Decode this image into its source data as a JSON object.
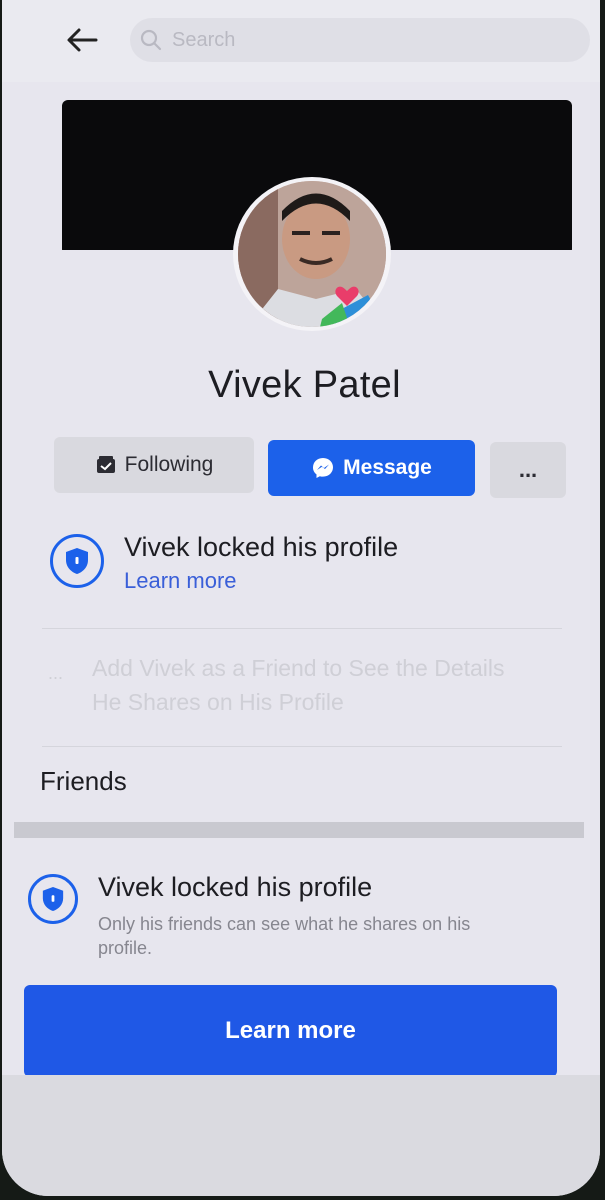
{
  "header": {
    "search_placeholder": "Search"
  },
  "profile": {
    "name": "Vivek Patel"
  },
  "actions": {
    "following_label": "Following",
    "message_label": "Message",
    "more_label": "..."
  },
  "lock_notice": {
    "title": "Vivek locked his profile",
    "link": "Learn more"
  },
  "locked_info": {
    "dots": "...",
    "text": "Add Vivek as a Friend to See the Details He Shares on His Profile"
  },
  "friends": {
    "label": "Friends",
    "lock_title": "Vivek locked his profile",
    "lock_description": "Only his friends can see what he shares on his profile.",
    "button_label": "Learn more"
  },
  "colors": {
    "accent": "#1c61ea",
    "background": "#e7e6ee"
  }
}
